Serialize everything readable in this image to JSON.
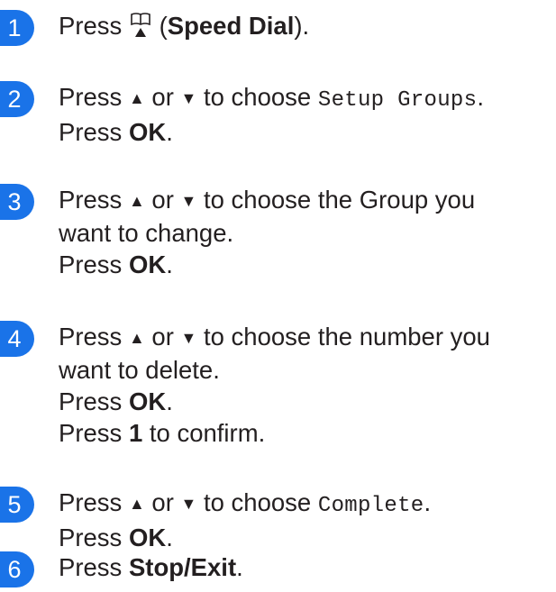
{
  "steps": [
    {
      "number": "1",
      "press": "Press",
      "paren_open": "(",
      "speed_dial": "Speed Dial",
      "paren_close": ")."
    },
    {
      "number": "2",
      "press": "Press",
      "up": "▲",
      "or": "or",
      "down": "▼",
      "to_choose": "to choose",
      "option": "Setup Groups",
      "period": ".",
      "press2": "Press",
      "ok": "OK",
      "period2": "."
    },
    {
      "number": "3",
      "press": "Press",
      "up": "▲",
      "or": "or",
      "down": "▼",
      "line1_rest": "to choose the Group you",
      "line2": "want to change.",
      "press2": "Press",
      "ok": "OK",
      "period2": "."
    },
    {
      "number": "4",
      "press": "Press",
      "up": "▲",
      "or": "or",
      "down": "▼",
      "line1_rest": "to choose the number you",
      "line2": "want to delete.",
      "press2": "Press",
      "ok": "OK",
      "period2": ".",
      "press3": "Press",
      "key1": "1",
      "confirm": "to confirm."
    },
    {
      "number": "5",
      "press": "Press",
      "up": "▲",
      "or": "or",
      "down": "▼",
      "to_choose": "to choose",
      "option": "Complete",
      "period": ".",
      "press2": "Press",
      "ok": "OK",
      "period2": "."
    },
    {
      "number": "6",
      "press": "Press",
      "stop_exit": "Stop/Exit",
      "period": "."
    }
  ],
  "colors": {
    "badge": "#1a73e8",
    "text": "#231f20"
  },
  "icons": {
    "speed_dial": "address-book-icon"
  }
}
